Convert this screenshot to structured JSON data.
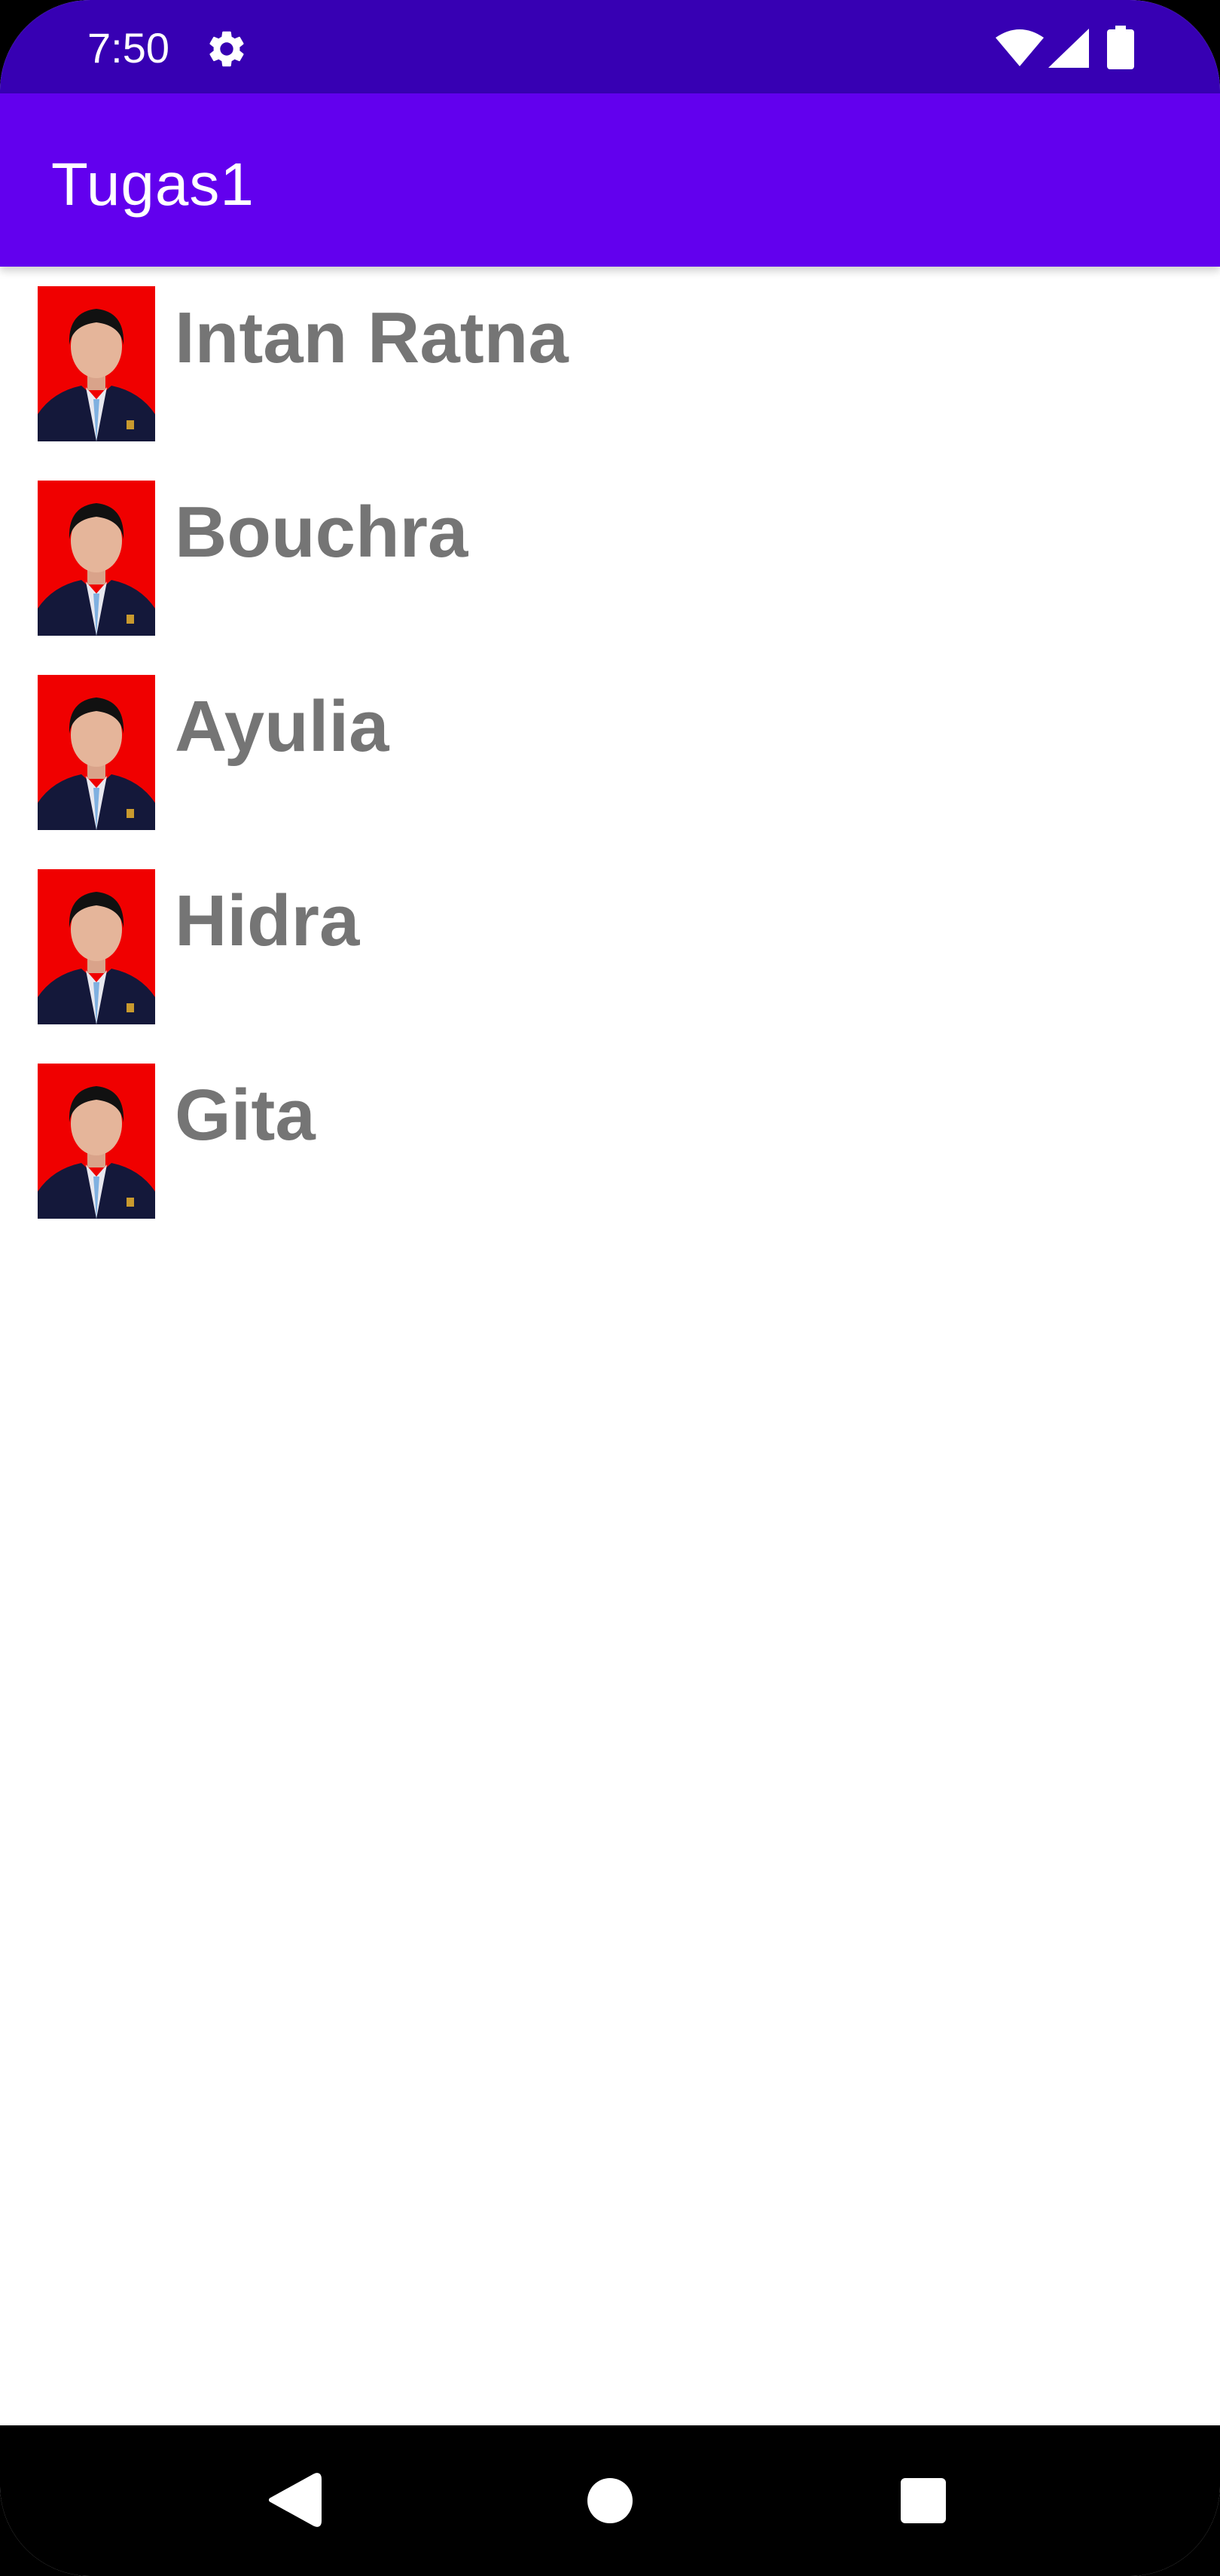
{
  "status_bar": {
    "time": "7:50",
    "icons": [
      "gear-icon",
      "wifi-icon",
      "signal-icon",
      "battery-icon"
    ]
  },
  "app_bar": {
    "title": "Tugas1"
  },
  "list": {
    "items": [
      {
        "name": "Intan Ratna",
        "avatar": "profile-photo"
      },
      {
        "name": "Bouchra",
        "avatar": "profile-photo"
      },
      {
        "name": "Ayulia",
        "avatar": "profile-photo"
      },
      {
        "name": "Hidra",
        "avatar": "profile-photo"
      },
      {
        "name": "Gita",
        "avatar": "profile-photo"
      }
    ]
  },
  "nav_bar": {
    "buttons": [
      "back-icon",
      "home-icon",
      "recents-icon"
    ]
  },
  "colors": {
    "status_bar": "#3700b3",
    "app_bar": "#6200ee",
    "item_text": "#757575",
    "photo_background": "#f00000",
    "nav_bar": "#000000"
  }
}
